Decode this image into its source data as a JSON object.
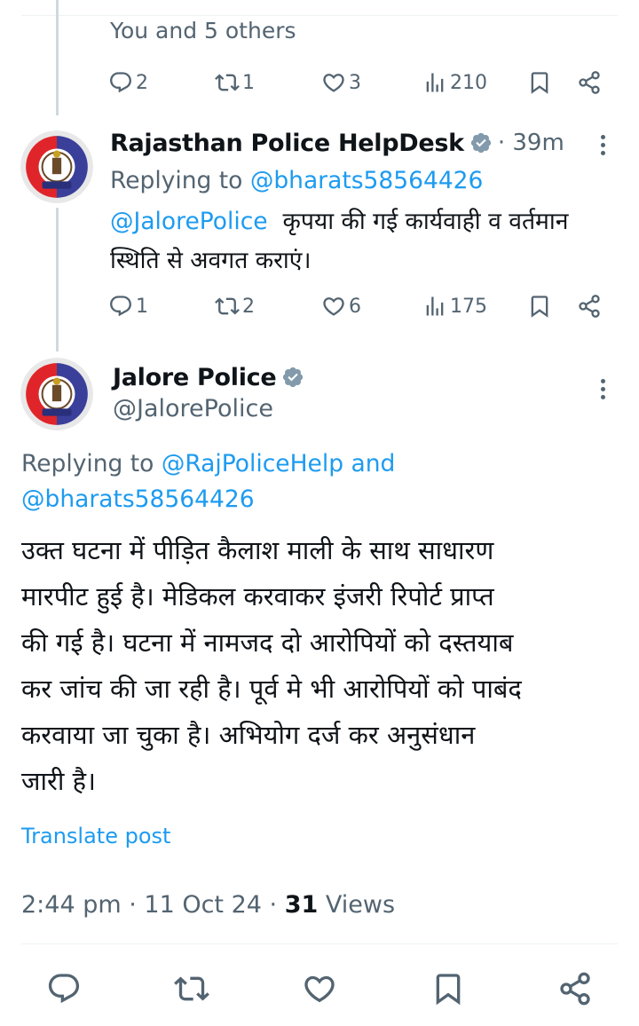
{
  "prev_tweet": {
    "likers_text": "You and 5 others",
    "stats": {
      "replies": "2",
      "reposts": "1",
      "likes": "3",
      "views": "210"
    }
  },
  "reply_tweet": {
    "name": "Rajasthan Police HelpDesk",
    "time": "· 39m",
    "replying_prefix": "Replying to ",
    "replying_handle": "@bharats58564426",
    "mention": "@JalorePolice",
    "text_line1": "कृपया की गई कार्यवाही व वर्तमान",
    "text_line2": "स्थिति से अवगत कराएं।",
    "stats": {
      "replies": "1",
      "reposts": "2",
      "likes": "6",
      "views": "175"
    }
  },
  "main_tweet": {
    "name": "Jalore Police",
    "handle": "@JalorePolice",
    "replying_prefix": "Replying to ",
    "replying_to_1": "@RajPoliceHelp",
    "replying_and": " and",
    "replying_to_2": "@bharats58564426",
    "body_lines": [
      "उक्त घटना में पीड़ित कैलाश माली के साथ साधारण",
      "मारपीट हुई है। मेडिकल करवाकर इंजरी रिपोर्ट प्राप्त",
      "की गई है। घटना में नामजद दो आरोपियों को दस्तयाब",
      "कर जांच की जा रही है। पूर्व मे भी आरोपियों को पाबंद",
      "करवाया जा चुका है। अभियोग दर्ज कर अनुसंधान",
      "जारी है।"
    ],
    "translate": "Translate post",
    "timestamp": "2:44 pm · 11 Oct 24 · ",
    "views_count": "31",
    "views_label": " Views"
  },
  "colors": {
    "link": "#1d9bf0",
    "muted": "#536471",
    "verified": "#829aab",
    "text": "#0f1419"
  },
  "icons": [
    "reply-icon",
    "repost-icon",
    "like-icon",
    "views-icon",
    "bookmark-icon",
    "share-icon",
    "verified-badge-icon",
    "more-icon",
    "police-logo"
  ]
}
